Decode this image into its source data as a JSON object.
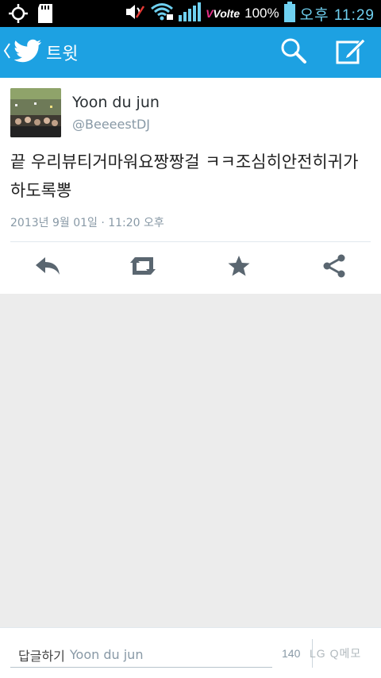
{
  "status_bar": {
    "battery": "100%",
    "time": "오후 11:29",
    "network": "Volte"
  },
  "action_bar": {
    "title": "트윗"
  },
  "tweet": {
    "name": "Yoon du jun",
    "handle": "@BeeeestDJ",
    "text": "끝 우리뷰티거마워요짱짱걸 ㅋㅋ조심히안전히귀가하도록뽕",
    "timestamp": "2013년 9월 01일 · 11:20 오후"
  },
  "reply": {
    "prefix": "답글하기",
    "recipient": "Yoon du jun",
    "char_count": "140",
    "watermark": "LG Q메모"
  },
  "colors": {
    "accent": "#1da1e2",
    "status_bg": "#000000",
    "empty_area": "#ececec"
  }
}
